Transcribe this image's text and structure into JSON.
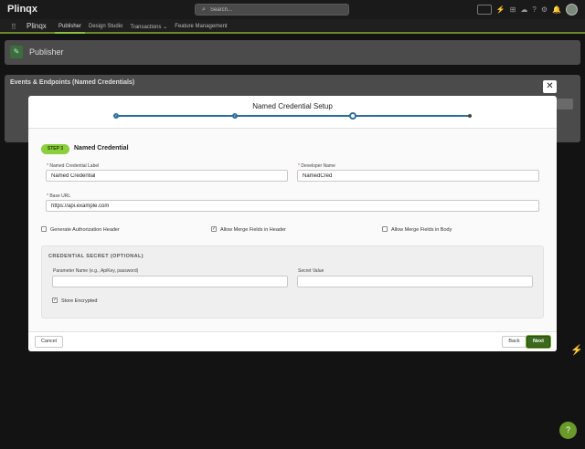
{
  "app": {
    "brand": "Plinqx",
    "search_placeholder": "Search...",
    "app_name": "Plinqx"
  },
  "nav": {
    "items": [
      {
        "label": "Publisher"
      },
      {
        "label": "Design Studio"
      },
      {
        "label": "Transactions ⌄"
      },
      {
        "label": "Feature Management"
      }
    ]
  },
  "background": {
    "page_title": "Publisher",
    "panel_title": "Events & Endpoints (Named Credentials)"
  },
  "modal": {
    "title": "Named Credential Setup",
    "close_glyph": "✕",
    "step_badge": "STEP 3",
    "step_title": "Named Credential",
    "fields": {
      "label_label": "Named Credential Label",
      "label_value": "Named Credential",
      "dev_name_label": "Developer Name",
      "dev_name_value": "NamedCred",
      "base_url_label": "Base URL",
      "base_url_value": "https://api.example.com"
    },
    "checkboxes": {
      "gen_auth_header": "Generate Authorization Header",
      "merge_header": "Allow Merge Fields in Header",
      "merge_body": "Allow Merge Fields in Body"
    },
    "secret": {
      "title": "CREDENTIAL SECRET (OPTIONAL)",
      "param_label": "Parameter Name (e.g., ApiKey, password)",
      "param_value": "",
      "secret_label": "Secret Value",
      "secret_value": "",
      "store_encrypted": "Store Encrypted"
    },
    "footer": {
      "cancel": "Cancel",
      "back": "Back",
      "next": "Next"
    }
  },
  "colors": {
    "accent_green": "#8bcf3d",
    "primary_button": "#3b6a1c",
    "progress_blue": "#2d6f9e"
  }
}
